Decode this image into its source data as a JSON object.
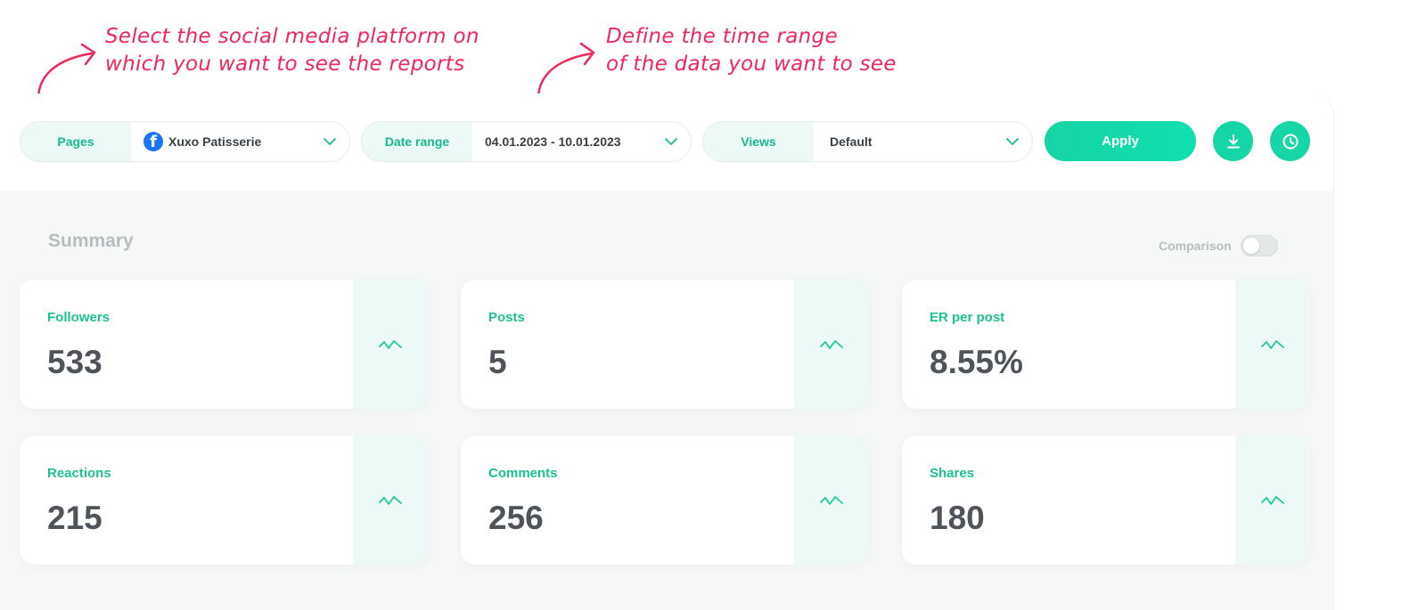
{
  "annotations": {
    "platform": [
      "Select the social media platform on",
      "which you want to see the reports"
    ],
    "time_range": [
      "Define the time range",
      "of the data you want to see"
    ]
  },
  "filters": {
    "pages": {
      "label": "Pages",
      "value": "Xuxo Patisserie",
      "icon": "facebook-icon"
    },
    "date_range": {
      "label": "Date range",
      "value": "04.01.2023 - 10.01.2023"
    },
    "views": {
      "label": "Views",
      "value": "Default"
    }
  },
  "toolbar": {
    "apply_label": "Apply",
    "download_icon": "download-icon",
    "history_icon": "clock-icon"
  },
  "summary": {
    "title": "Summary",
    "comparison_label": "Comparison",
    "comparison_on": false,
    "cards": [
      {
        "label": "Followers",
        "value": "533"
      },
      {
        "label": "Posts",
        "value": "5"
      },
      {
        "label": "ER per post",
        "value": "8.55%"
      },
      {
        "label": "Reactions",
        "value": "215"
      },
      {
        "label": "Comments",
        "value": "256"
      },
      {
        "label": "Shares",
        "value": "180"
      }
    ]
  },
  "colors": {
    "accent": "#16d6a8",
    "accent_text": "#1fbf96",
    "annotation": "#f0285a",
    "value_text": "#4e5459",
    "facebook": "#1877f2"
  }
}
